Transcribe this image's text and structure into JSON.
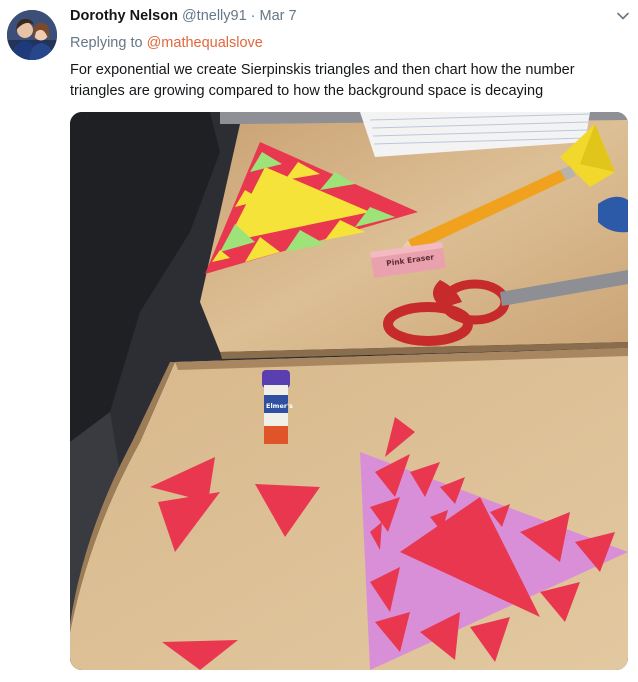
{
  "tweet": {
    "display_name": "Dorothy Nelson",
    "handle": "@tnelly91",
    "separator": "·",
    "date": "Mar 7",
    "replying_prefix": "Replying to",
    "replying_to": "@mathequalslove",
    "text": "For exponential we create Sierpinskis triangles and then chart how the number triangles are growing compared to how the background space is decaying"
  },
  "photo": {
    "eraser_text": "Pink Eraser",
    "glue_label": "Elmer's"
  },
  "icons": {
    "menu": "chevron-down-icon",
    "avatar": "avatar-photo"
  },
  "colors": {
    "link": "#e0673b",
    "secondary_text": "#657786",
    "primary_text": "#14171a",
    "desk": "#d9b98f",
    "triangle_red": "#e8374f",
    "triangle_yellow": "#f5e33a",
    "triangle_green": "#9ee37a",
    "triangle_lilac": "#d98fd8"
  }
}
